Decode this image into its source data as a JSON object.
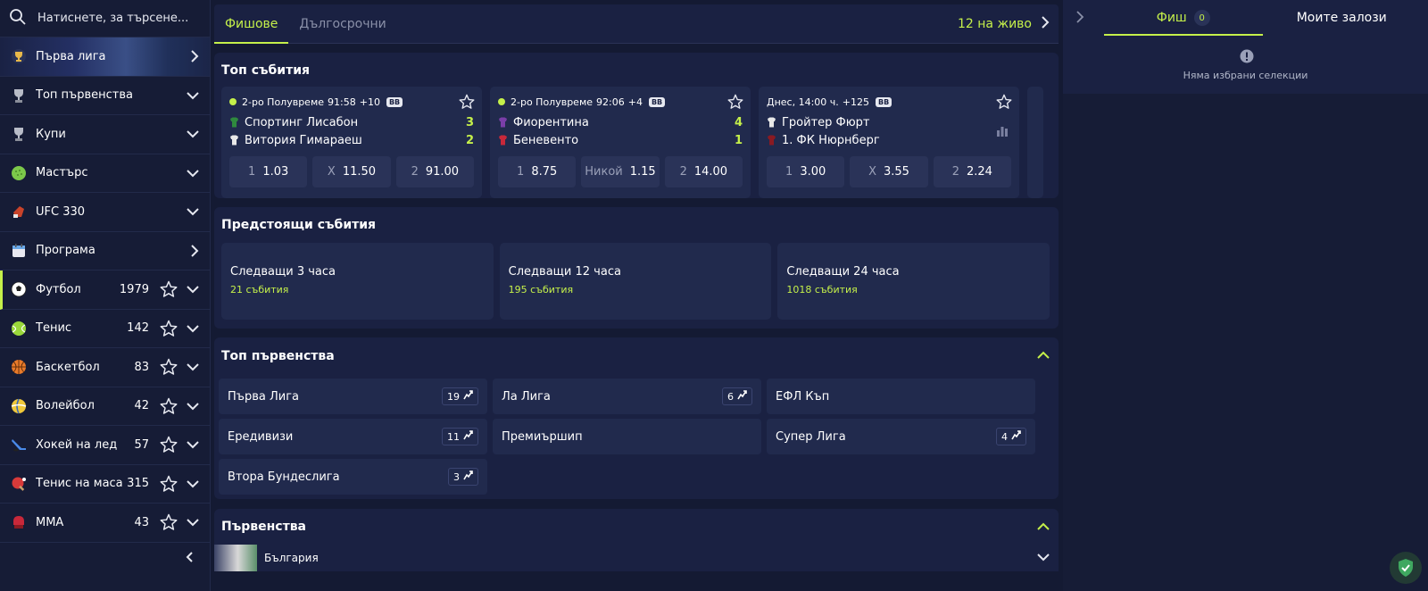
{
  "search": {
    "placeholder": "Натиснете, за търсене..."
  },
  "sidebar": {
    "items": [
      {
        "label": "Първа лига",
        "icon": "trophy-icon",
        "count": "",
        "star": false,
        "chevron": "right"
      },
      {
        "label": "Топ първенства",
        "icon": "cup-icon",
        "count": "",
        "star": false,
        "chevron": "down"
      },
      {
        "label": "Купи",
        "icon": "cup-icon",
        "count": "",
        "star": false,
        "chevron": "down"
      },
      {
        "label": "Мастърс",
        "icon": "golf-ball-icon",
        "count": "",
        "star": false,
        "chevron": "down"
      },
      {
        "label": "UFC 330",
        "icon": "boxing-glove-icon",
        "count": "",
        "star": false,
        "chevron": "down"
      },
      {
        "label": "Програма",
        "icon": "calendar-icon",
        "count": "",
        "star": false,
        "chevron": "right"
      },
      {
        "label": "Футбол",
        "icon": "football-icon",
        "count": "1979",
        "star": true,
        "chevron": "down"
      },
      {
        "label": "Тенис",
        "icon": "tennis-ball-icon",
        "count": "142",
        "star": true,
        "chevron": "down"
      },
      {
        "label": "Баскетбол",
        "icon": "basketball-icon",
        "count": "83",
        "star": true,
        "chevron": "down"
      },
      {
        "label": "Волейбол",
        "icon": "volleyball-icon",
        "count": "42",
        "star": true,
        "chevron": "down"
      },
      {
        "label": "Хокей на лед",
        "icon": "ice-hockey-icon",
        "count": "57",
        "star": true,
        "chevron": "down"
      },
      {
        "label": "Тенис на маса",
        "icon": "table-tennis-icon",
        "count": "315",
        "star": true,
        "chevron": "down"
      },
      {
        "label": "ММА",
        "icon": "mma-glove-icon",
        "count": "43",
        "star": true,
        "chevron": "down"
      }
    ]
  },
  "main": {
    "tabs": [
      {
        "label": "Фишове"
      },
      {
        "label": "Дългосрочни"
      }
    ],
    "live_link": "12 на живо",
    "top_events": {
      "title": "Топ събития",
      "events": [
        {
          "status": "2-ро Полувреме",
          "time": "91:58",
          "extra": "+10",
          "bb": "BB",
          "live": true,
          "home": "Спортинг Лисабон",
          "away": "Витория Гимараеш",
          "home_score": "3",
          "away_score": "2",
          "home_color": "#2f8a3e",
          "away_color": "#e8e8e8",
          "odds": [
            {
              "label": "1",
              "value": "1.03"
            },
            {
              "label": "X",
              "value": "11.50"
            },
            {
              "label": "2",
              "value": "91.00"
            }
          ]
        },
        {
          "status": "2-ро Полувреме",
          "time": "92:06",
          "extra": "+4",
          "bb": "BB",
          "live": true,
          "home": "Фиорентина",
          "away": "Беневенто",
          "home_score": "4",
          "away_score": "1",
          "home_color": "#7a3ea8",
          "away_color": "#c8283a",
          "odds": [
            {
              "label": "1",
              "value": "8.75"
            },
            {
              "label": "Никой",
              "value": "1.15"
            },
            {
              "label": "2",
              "value": "14.00"
            }
          ]
        },
        {
          "status": "Днес, 14:00 ч.",
          "time": "",
          "extra": "+125",
          "bb": "BB",
          "live": false,
          "home": "Гройтер Фюрт",
          "away": "1. ФК Нюрнберг",
          "home_score": "",
          "away_score": "",
          "home_color": "#e8e8e8",
          "away_color": "#8a1a22",
          "odds": [
            {
              "label": "1",
              "value": "3.00"
            },
            {
              "label": "X",
              "value": "3.55"
            },
            {
              "label": "2",
              "value": "2.24"
            }
          ]
        }
      ]
    },
    "upcoming": {
      "title": "Предстоящи събития",
      "cards": [
        {
          "title": "Следващи 3 часа",
          "count": "21 събития"
        },
        {
          "title": "Следващи 12 часа",
          "count": "195 събития"
        },
        {
          "title": "Следващи 24 часа",
          "count": "1018 събития"
        }
      ]
    },
    "top_leagues": {
      "title": "Топ първенства",
      "items": [
        {
          "name": "Първа Лига",
          "count": "19"
        },
        {
          "name": "Ла Лига",
          "count": "6"
        },
        {
          "name": "ЕФЛ Къп",
          "count": ""
        },
        {
          "name": "Ередивизи",
          "count": "11"
        },
        {
          "name": "Премиършип",
          "count": ""
        },
        {
          "name": "Супер Лига",
          "count": "4"
        },
        {
          "name": "Втора Бундеслига",
          "count": "3"
        }
      ]
    },
    "championships": {
      "title": "Първенства",
      "countries": [
        {
          "name": "България"
        }
      ]
    }
  },
  "betslip": {
    "tabs": [
      {
        "label": "Фиш",
        "badge": "0"
      },
      {
        "label": "Моите залози",
        "badge": ""
      }
    ],
    "empty_text": "Няма избрани селекции"
  },
  "colors": {
    "accent": "#c5f04a",
    "bg": "#141a33",
    "panel": "#1a2142",
    "card": "#212a4d"
  }
}
